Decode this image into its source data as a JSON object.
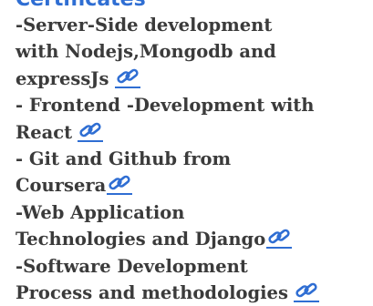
{
  "section": {
    "title": "Certificates"
  },
  "certificates": [
    {
      "lines": [
        "-Server-Side development",
        "with Nodejs,Mongodb and",
        "expressJs"
      ],
      "link_icon": "chain-link-icon"
    },
    {
      "lines": [
        "- Frontend -Development with",
        "React"
      ],
      "link_icon": "chain-link-icon"
    },
    {
      "lines": [
        "- Git and Github from",
        "Coursera"
      ],
      "link_icon": "chain-link-icon"
    },
    {
      "lines": [
        "-Web Application",
        "Technologies and Django"
      ],
      "link_icon": "chain-link-icon"
    },
    {
      "lines": [
        "-Software Development",
        "Process and methodologies"
      ],
      "link_icon": "chain-link-icon"
    }
  ],
  "colors": {
    "heading": "#2f6ed3",
    "text": "#3b3b3b",
    "link_icon": "#2f6ed3"
  }
}
